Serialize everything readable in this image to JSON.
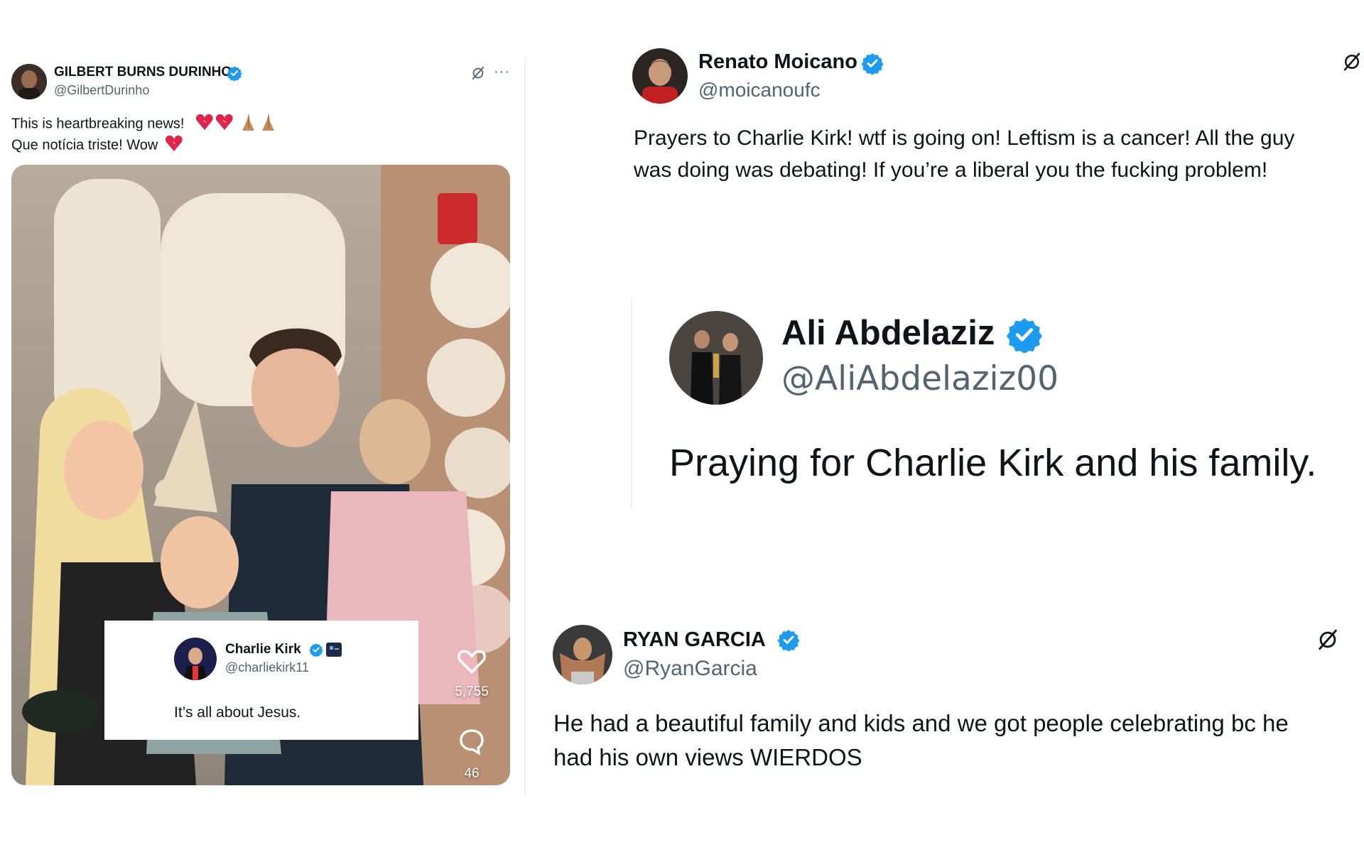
{
  "colors": {
    "verified": "#1d9bf0",
    "text": "#0f1419",
    "secondary": "#536471",
    "emoji_red": "#e0244a",
    "hands": "#c98b55"
  },
  "post_gilbert": {
    "name": "GILBERT BURNS DURINHO",
    "handle": "@GilbertDurinho",
    "line1": "This is heartbreaking news!",
    "line2": "Que notícia triste! Wow",
    "icons": [
      "grok-icon",
      "more-icon",
      "broken-heart-icon",
      "folded-hands-icon"
    ],
    "more": "···",
    "embedded": {
      "name": "Charlie Kirk",
      "handle": "@charliekirk11",
      "text": "It’s all about Jesus.",
      "likes": "5,755",
      "comments": "46"
    }
  },
  "post_renato": {
    "name": "Renato Moicano",
    "handle": "@moicanoufc",
    "line1": "Prayers to Charlie Kirk! wtf is going on! Leftism is a cancer! All the guy",
    "line2": "was doing was debating! If you’re a liberal you the fucking problem!"
  },
  "post_ali": {
    "name": "Ali Abdelaziz",
    "handle": "@AliAbdelaziz00",
    "text": "Praying for Charlie Kirk and his family."
  },
  "post_ryan": {
    "name": "RYAN GARCIA",
    "handle": "@RyanGarcia",
    "line1": "He had a beautiful family and kids and we got people celebrating bc he",
    "line2": "had his own views WIERDOS"
  }
}
